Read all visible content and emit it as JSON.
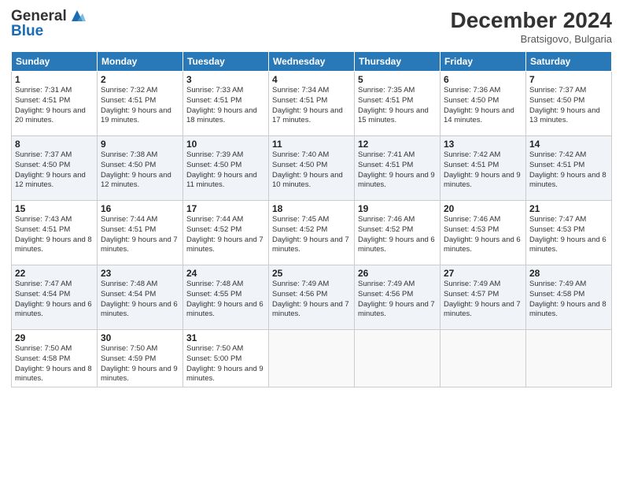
{
  "header": {
    "logo_line1": "General",
    "logo_line2": "Blue",
    "month": "December 2024",
    "location": "Bratsigovo, Bulgaria"
  },
  "days_of_week": [
    "Sunday",
    "Monday",
    "Tuesday",
    "Wednesday",
    "Thursday",
    "Friday",
    "Saturday"
  ],
  "weeks": [
    [
      {
        "day": 1,
        "sunrise": "7:31 AM",
        "sunset": "4:51 PM",
        "daylight": "9 hours and 20 minutes."
      },
      {
        "day": 2,
        "sunrise": "7:32 AM",
        "sunset": "4:51 PM",
        "daylight": "9 hours and 19 minutes."
      },
      {
        "day": 3,
        "sunrise": "7:33 AM",
        "sunset": "4:51 PM",
        "daylight": "9 hours and 18 minutes."
      },
      {
        "day": 4,
        "sunrise": "7:34 AM",
        "sunset": "4:51 PM",
        "daylight": "9 hours and 17 minutes."
      },
      {
        "day": 5,
        "sunrise": "7:35 AM",
        "sunset": "4:51 PM",
        "daylight": "9 hours and 15 minutes."
      },
      {
        "day": 6,
        "sunrise": "7:36 AM",
        "sunset": "4:50 PM",
        "daylight": "9 hours and 14 minutes."
      },
      {
        "day": 7,
        "sunrise": "7:37 AM",
        "sunset": "4:50 PM",
        "daylight": "9 hours and 13 minutes."
      }
    ],
    [
      {
        "day": 8,
        "sunrise": "7:37 AM",
        "sunset": "4:50 PM",
        "daylight": "9 hours and 12 minutes."
      },
      {
        "day": 9,
        "sunrise": "7:38 AM",
        "sunset": "4:50 PM",
        "daylight": "9 hours and 12 minutes."
      },
      {
        "day": 10,
        "sunrise": "7:39 AM",
        "sunset": "4:50 PM",
        "daylight": "9 hours and 11 minutes."
      },
      {
        "day": 11,
        "sunrise": "7:40 AM",
        "sunset": "4:50 PM",
        "daylight": "9 hours and 10 minutes."
      },
      {
        "day": 12,
        "sunrise": "7:41 AM",
        "sunset": "4:51 PM",
        "daylight": "9 hours and 9 minutes."
      },
      {
        "day": 13,
        "sunrise": "7:42 AM",
        "sunset": "4:51 PM",
        "daylight": "9 hours and 9 minutes."
      },
      {
        "day": 14,
        "sunrise": "7:42 AM",
        "sunset": "4:51 PM",
        "daylight": "9 hours and 8 minutes."
      }
    ],
    [
      {
        "day": 15,
        "sunrise": "7:43 AM",
        "sunset": "4:51 PM",
        "daylight": "9 hours and 8 minutes."
      },
      {
        "day": 16,
        "sunrise": "7:44 AM",
        "sunset": "4:51 PM",
        "daylight": "9 hours and 7 minutes."
      },
      {
        "day": 17,
        "sunrise": "7:44 AM",
        "sunset": "4:52 PM",
        "daylight": "9 hours and 7 minutes."
      },
      {
        "day": 18,
        "sunrise": "7:45 AM",
        "sunset": "4:52 PM",
        "daylight": "9 hours and 7 minutes."
      },
      {
        "day": 19,
        "sunrise": "7:46 AM",
        "sunset": "4:52 PM",
        "daylight": "9 hours and 6 minutes."
      },
      {
        "day": 20,
        "sunrise": "7:46 AM",
        "sunset": "4:53 PM",
        "daylight": "9 hours and 6 minutes."
      },
      {
        "day": 21,
        "sunrise": "7:47 AM",
        "sunset": "4:53 PM",
        "daylight": "9 hours and 6 minutes."
      }
    ],
    [
      {
        "day": 22,
        "sunrise": "7:47 AM",
        "sunset": "4:54 PM",
        "daylight": "9 hours and 6 minutes."
      },
      {
        "day": 23,
        "sunrise": "7:48 AM",
        "sunset": "4:54 PM",
        "daylight": "9 hours and 6 minutes."
      },
      {
        "day": 24,
        "sunrise": "7:48 AM",
        "sunset": "4:55 PM",
        "daylight": "9 hours and 6 minutes."
      },
      {
        "day": 25,
        "sunrise": "7:49 AM",
        "sunset": "4:56 PM",
        "daylight": "9 hours and 7 minutes."
      },
      {
        "day": 26,
        "sunrise": "7:49 AM",
        "sunset": "4:56 PM",
        "daylight": "9 hours and 7 minutes."
      },
      {
        "day": 27,
        "sunrise": "7:49 AM",
        "sunset": "4:57 PM",
        "daylight": "9 hours and 7 minutes."
      },
      {
        "day": 28,
        "sunrise": "7:49 AM",
        "sunset": "4:58 PM",
        "daylight": "9 hours and 8 minutes."
      }
    ],
    [
      {
        "day": 29,
        "sunrise": "7:50 AM",
        "sunset": "4:58 PM",
        "daylight": "9 hours and 8 minutes."
      },
      {
        "day": 30,
        "sunrise": "7:50 AM",
        "sunset": "4:59 PM",
        "daylight": "9 hours and 9 minutes."
      },
      {
        "day": 31,
        "sunrise": "7:50 AM",
        "sunset": "5:00 PM",
        "daylight": "9 hours and 9 minutes."
      },
      null,
      null,
      null,
      null
    ]
  ]
}
